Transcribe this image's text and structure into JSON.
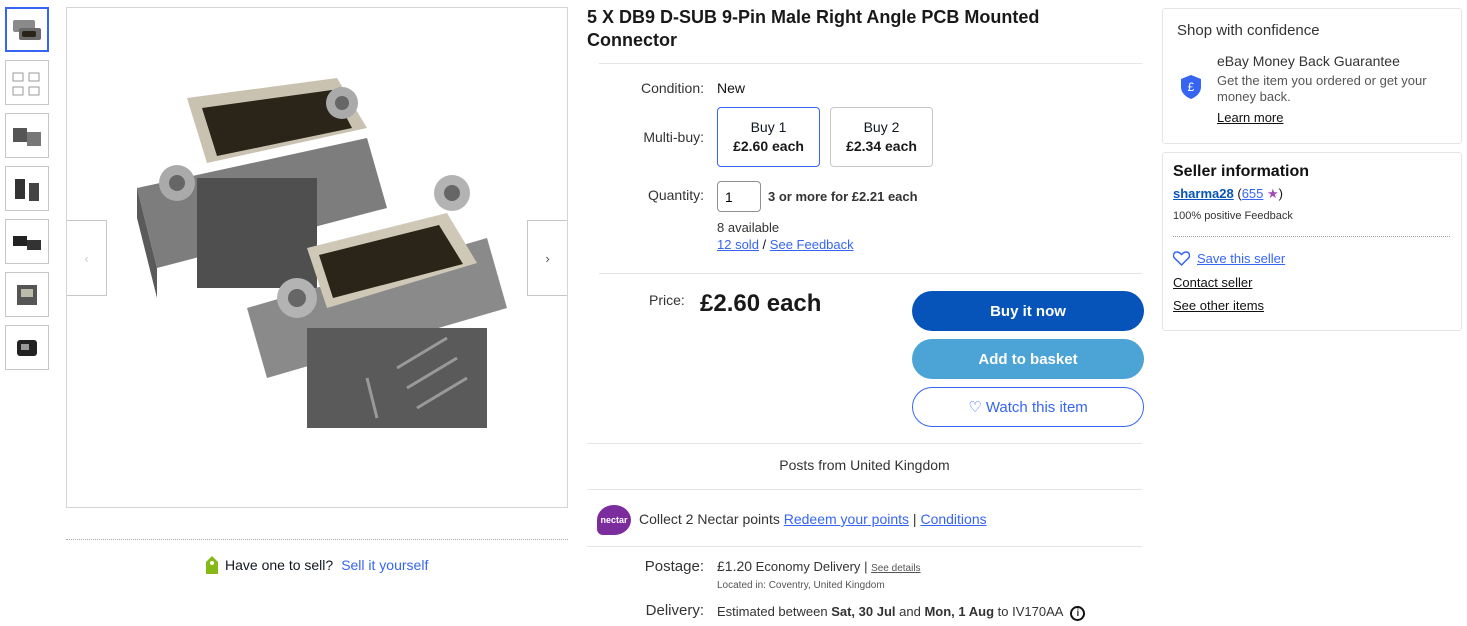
{
  "gallery": {
    "thumbnail_count": 7,
    "active_index": 0,
    "prev_glyph": "‹",
    "next_glyph": "›"
  },
  "sell": {
    "question": "Have one to sell?",
    "link": "Sell it yourself"
  },
  "listing": {
    "title": "5 X DB9 D-SUB 9-Pin Male Right Angle PCB Mounted Connector",
    "condition_label": "Condition:",
    "condition_value": "New",
    "multibuy_label": "Multi-buy:",
    "multibuy_options": [
      {
        "qty": "Buy 1",
        "price": "£2.60 each",
        "selected": true
      },
      {
        "qty": "Buy 2",
        "price": "£2.34 each",
        "selected": false
      }
    ],
    "quantity_label": "Quantity:",
    "quantity_value": "1",
    "quantity_offer": "3 or more for £2.21 each",
    "available": "8 available",
    "sold": "12 sold",
    "sold_separator": "/",
    "see_feedback": "See Feedback",
    "price_label": "Price:",
    "price_value": "£2.60 each",
    "buy_now": "Buy it now",
    "add_basket": "Add to basket",
    "watch": "♡ Watch this item",
    "posts_from": "Posts from United Kingdom",
    "nectar_logo": "nectar",
    "nectar_collect": "Collect 2 Nectar points",
    "nectar_redeem": "Redeem your points",
    "nectar_sep": "|",
    "nectar_conditions": "Conditions",
    "postage_label": "Postage:",
    "postage_price": "£1.20",
    "postage_service": "Economy Delivery",
    "postage_sep": "|",
    "postage_details": "See details",
    "postage_location": "Located in: Coventry, United Kingdom",
    "delivery_label": "Delivery:",
    "delivery_prefix": "Estimated between",
    "delivery_from": "Sat, 30 Jul",
    "delivery_and": "and",
    "delivery_to": "Mon, 1 Aug",
    "delivery_to_word": "to",
    "delivery_postcode": "IV170AA",
    "info_glyph": "i"
  },
  "confidence": {
    "title": "Shop with confidence",
    "guarantee_title": "eBay Money Back Guarantee",
    "guarantee_text": "Get the item you ordered or get your money back.",
    "learn_more": "Learn more"
  },
  "seller": {
    "title": "Seller information",
    "name": "sharma28",
    "score_open": "(",
    "score": "655",
    "score_close": ")",
    "star": "★",
    "positive": "100% positive Feedback",
    "save": "Save this seller",
    "contact": "Contact seller",
    "other_items": "See other items"
  },
  "colors": {
    "link": "#3665f3",
    "buy_now_bg": "#0654ba",
    "basket_bg": "#4ba3d6",
    "nectar": "#7b2d9e",
    "star": "#a34cb8"
  }
}
